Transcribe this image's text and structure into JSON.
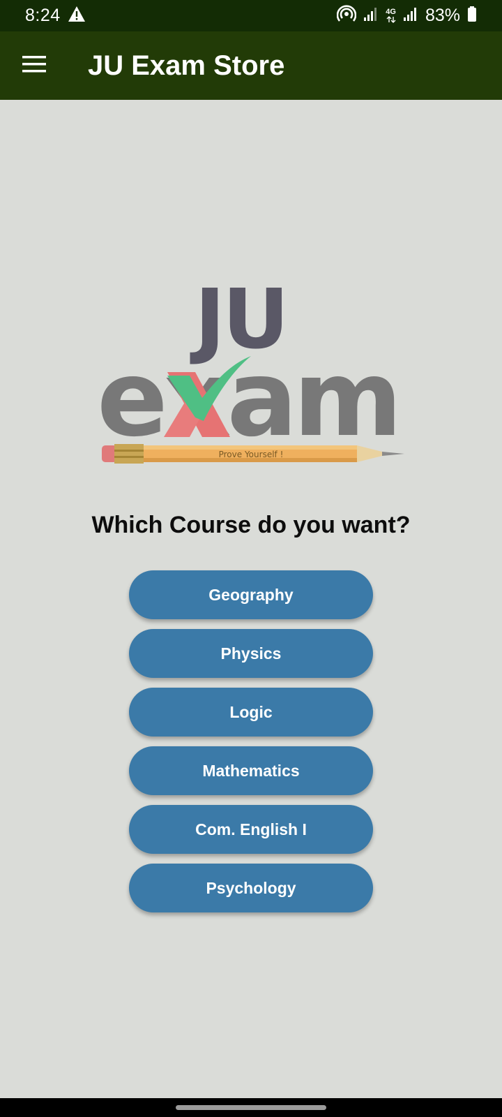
{
  "status_bar": {
    "time": "8:24",
    "battery": "83%",
    "network_type": "4G",
    "icons": [
      "warning-icon",
      "hotspot-icon",
      "signal-icon",
      "signal-icon",
      "battery-icon"
    ]
  },
  "app_bar": {
    "title": "JU Exam Store",
    "menu_icon": "hamburger-menu-icon"
  },
  "logo": {
    "line1": "JU",
    "line2": "exam",
    "tagline": "Prove Yourself !"
  },
  "question": "Which Course do you want?",
  "courses": [
    {
      "label": "Geography"
    },
    {
      "label": "Physics"
    },
    {
      "label": "Logic"
    },
    {
      "label": "Mathematics"
    },
    {
      "label": "Com. English I"
    },
    {
      "label": "Psychology"
    }
  ],
  "colors": {
    "status_bar": "#132c05",
    "app_bar": "#223b07",
    "background": "#dadcd8",
    "button": "#3b7aa8"
  }
}
